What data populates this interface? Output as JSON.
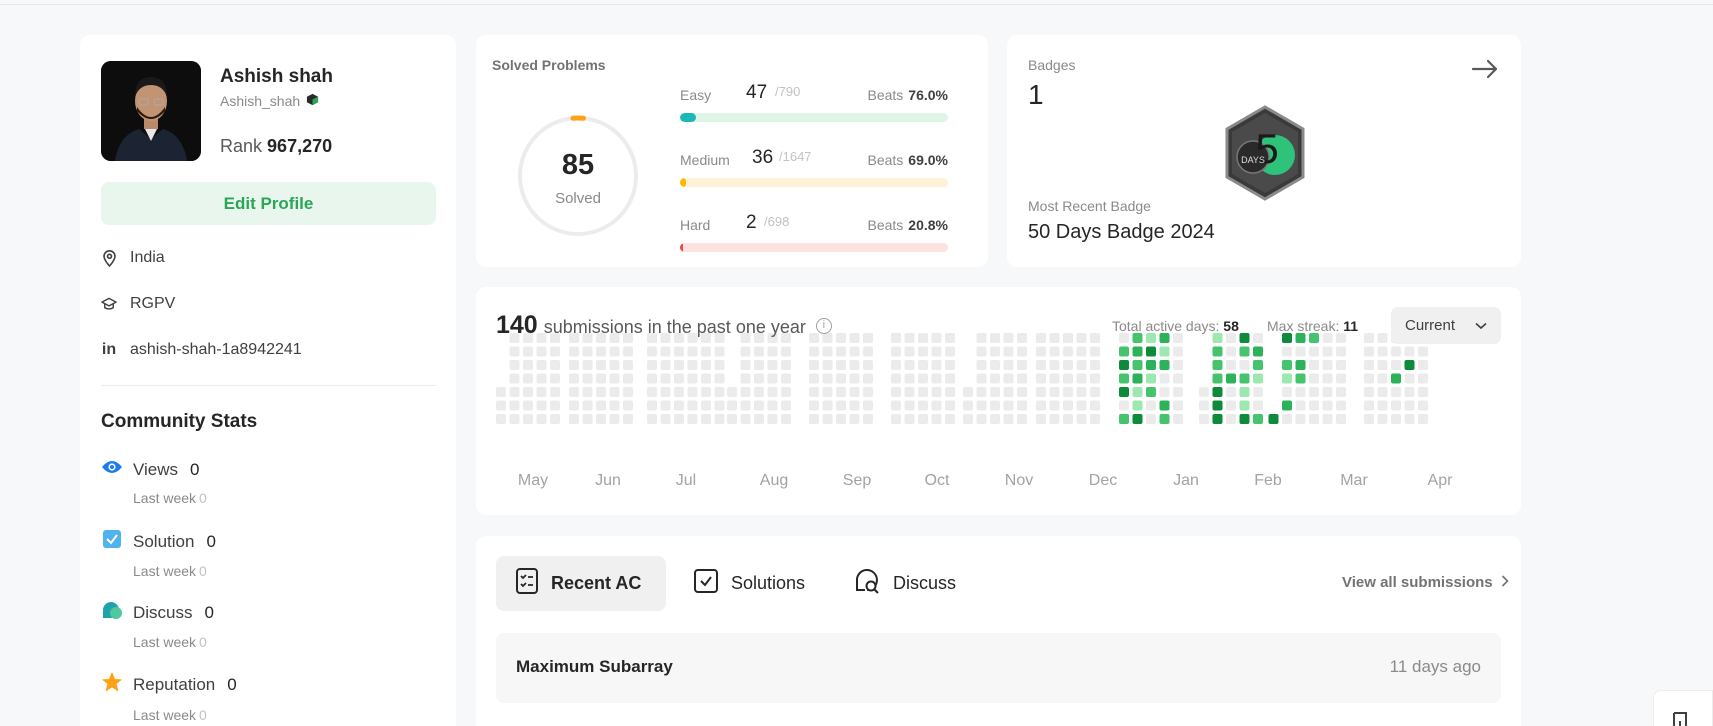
{
  "profile": {
    "name": "Ashish shah",
    "username": "Ashish_shah",
    "rank_label": "Rank",
    "rank_value": "967,270",
    "edit_label": "Edit Profile",
    "location": "India",
    "school": "RGPV",
    "linkedin": "ashish-shah-1a8942241"
  },
  "community": {
    "title": "Community Stats",
    "last_week_label": "Last week",
    "stats": [
      {
        "label": "Views",
        "value": "0",
        "last_week": "0",
        "icon": "eye-icon",
        "color": "#1a7cf0"
      },
      {
        "label": "Solution",
        "value": "0",
        "last_week": "0",
        "icon": "check-square-icon",
        "color": "#4fb3f0"
      },
      {
        "label": "Discuss",
        "value": "0",
        "last_week": "0",
        "icon": "discuss-icon",
        "color": "#1fa3a8"
      },
      {
        "label": "Reputation",
        "value": "0",
        "last_week": "0",
        "icon": "star-icon",
        "color": "#ffa116"
      }
    ]
  },
  "solved": {
    "title": "Solved Problems",
    "total": "85",
    "total_label": "Solved",
    "progress": 0.029,
    "difficulties": [
      {
        "label": "Easy",
        "count": "47",
        "total": "/790",
        "beats_label": "Beats",
        "beats": "76.0%",
        "fraction": 0.059,
        "color": "#1cb8b8",
        "track": "#dff5e8"
      },
      {
        "label": "Medium",
        "count": "36",
        "total": "/1647",
        "beats_label": "Beats",
        "beats": "69.0%",
        "fraction": 0.022,
        "color": "#ffb800",
        "track": "#fff1d6"
      },
      {
        "label": "Hard",
        "count": "2",
        "total": "/698",
        "beats_label": "Beats",
        "beats": "20.8%",
        "fraction": 0.003,
        "color": "#ef4743",
        "track": "#fde2e2"
      }
    ]
  },
  "badges": {
    "title": "Badges",
    "count": "1",
    "recent_label": "Most Recent Badge",
    "recent_value": "50 Days Badge 2024",
    "badge_digit": "5",
    "badge_text": "DAYS"
  },
  "calendar": {
    "count": "140",
    "text": "submissions in the past one year",
    "active_label": "Total active days:",
    "active_value": "58",
    "streak_label": "Max streak:",
    "streak_value": "11",
    "select_value": "Current",
    "months": [
      "May",
      "Jun",
      "Jul",
      "Aug",
      "Sep",
      "Oct",
      "Nov",
      "Dec",
      "Jan",
      "Feb",
      "Mar",
      "Apr"
    ]
  },
  "recent": {
    "tabs": [
      {
        "label": "Recent AC",
        "icon": "list-icon"
      },
      {
        "label": "Solutions",
        "icon": "check-box-icon"
      },
      {
        "label": "Discuss",
        "icon": "chat-icon"
      }
    ],
    "view_all": "View all submissions",
    "items": [
      {
        "title": "Maximum Subarray",
        "time": "11 days ago"
      }
    ]
  }
}
